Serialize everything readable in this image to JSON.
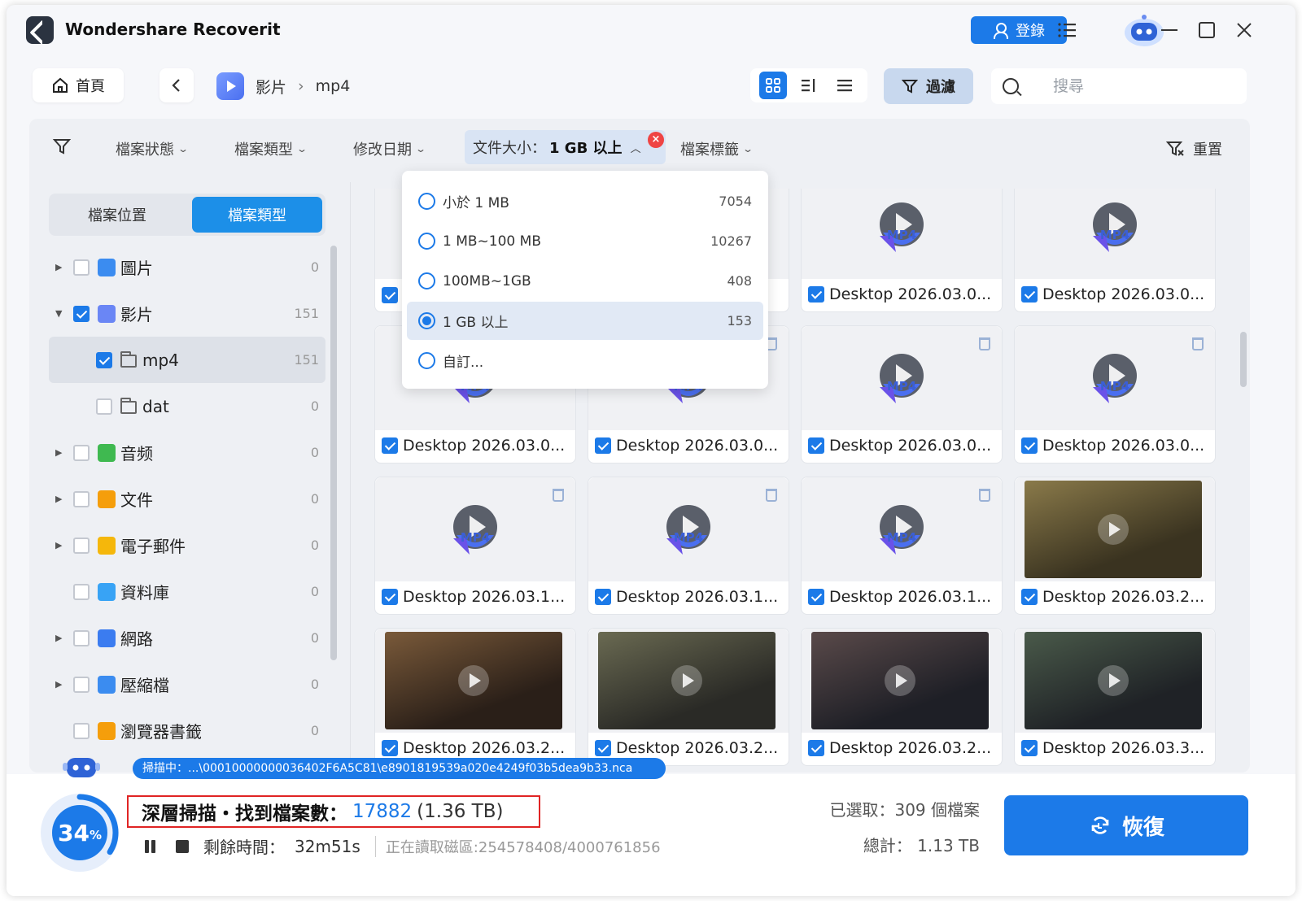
{
  "app": {
    "title": "Wondershare Recoverit",
    "login_label": "登錄"
  },
  "toolbar": {
    "home_label": "首頁",
    "breadcrumb": [
      "影片",
      "mp4"
    ],
    "breadcrumb_sep": "›",
    "filter_label": "過濾",
    "search_placeholder": "搜尋",
    "view_mode_active": "grid"
  },
  "filter_bar": {
    "items": [
      "檔案狀態",
      "檔案類型",
      "修改日期",
      "檔案標籤"
    ],
    "size_filter_prefix": "文件大小：",
    "size_filter_value": "1 GB 以上",
    "reset_label": "重置"
  },
  "dropdown": {
    "options": [
      {
        "label": "小於 1 MB",
        "count": "7054",
        "selected": false
      },
      {
        "label": "1 MB~100 MB",
        "count": "10267",
        "selected": false
      },
      {
        "label": "100MB~1GB",
        "count": "408",
        "selected": false
      },
      {
        "label": "1 GB 以上",
        "count": "153",
        "selected": true
      },
      {
        "label": "自訂...",
        "count": "",
        "selected": false
      }
    ]
  },
  "sidebar": {
    "tabs": [
      "檔案位置",
      "檔案類型"
    ],
    "active_tab": "檔案類型",
    "tree": [
      {
        "label": "圖片",
        "count": "0",
        "checked": false,
        "expandable": true,
        "icon": "image-icon",
        "color": "#3b8cf0"
      },
      {
        "label": "影片",
        "count": "151",
        "checked": true,
        "expandable": true,
        "expanded": true,
        "icon": "video-icon",
        "color": "#6a86f5"
      },
      {
        "label": "mp4",
        "count": "151",
        "checked": true,
        "child": true,
        "selected": true,
        "icon": "folder-icon"
      },
      {
        "label": "dat",
        "count": "0",
        "checked": false,
        "child": true,
        "icon": "folder-icon"
      },
      {
        "label": "音频",
        "count": "0",
        "checked": false,
        "expandable": true,
        "icon": "audio-icon",
        "color": "#3fb950"
      },
      {
        "label": "文件",
        "count": "0",
        "checked": false,
        "expandable": true,
        "icon": "document-icon",
        "color": "#f59e0b"
      },
      {
        "label": "電子郵件",
        "count": "0",
        "checked": false,
        "expandable": true,
        "icon": "email-icon",
        "color": "#f5b70b"
      },
      {
        "label": "資料庫",
        "count": "0",
        "checked": false,
        "expandable": false,
        "icon": "database-icon",
        "color": "#38a3f5"
      },
      {
        "label": "網路",
        "count": "0",
        "checked": false,
        "expandable": true,
        "icon": "web-icon",
        "color": "#3b7cf0"
      },
      {
        "label": "壓縮檔",
        "count": "0",
        "checked": false,
        "expandable": true,
        "icon": "archive-icon",
        "color": "#3b8cf0"
      },
      {
        "label": "瀏覽器書籤",
        "count": "0",
        "checked": false,
        "expandable": false,
        "icon": "bookmark-icon",
        "color": "#f59e0b"
      }
    ]
  },
  "grid": {
    "rows": [
      [
        {
          "name": "",
          "type": "mp4",
          "hidden_by_dropdown": true
        },
        {
          "name": "",
          "type": "mp4",
          "hidden_by_dropdown": true
        },
        {
          "name": "Desktop 2026.03.0...",
          "type": "mp4"
        },
        {
          "name": "Desktop 2026.03.0...",
          "type": "mp4"
        }
      ],
      [
        {
          "name": "Desktop 2026.03.0...",
          "type": "mp4"
        },
        {
          "name": "Desktop 2026.03.0...",
          "type": "mp4"
        },
        {
          "name": "Desktop 2026.03.0...",
          "type": "mp4"
        },
        {
          "name": "Desktop 2026.03.0...",
          "type": "mp4"
        }
      ],
      [
        {
          "name": "Desktop 2026.03.1...",
          "type": "mp4"
        },
        {
          "name": "Desktop 2026.03.1...",
          "type": "mp4"
        },
        {
          "name": "Desktop 2026.03.1...",
          "type": "mp4"
        },
        {
          "name": "Desktop 2026.03.2...",
          "type": "preview",
          "preview_colors": [
            "#3a3320",
            "#8a7a4a"
          ]
        }
      ],
      [
        {
          "name": "Desktop 2026.03.2...",
          "type": "preview",
          "preview_colors": [
            "#2a1f18",
            "#7a5a3a"
          ]
        },
        {
          "name": "Desktop 2026.03.2...",
          "type": "preview",
          "preview_colors": [
            "#2a2a26",
            "#6a6a52"
          ]
        },
        {
          "name": "Desktop 2026.03.2...",
          "type": "preview",
          "preview_colors": [
            "#1e1f26",
            "#5a4a4a"
          ]
        },
        {
          "name": "Desktop 2026.03.3...",
          "type": "preview",
          "preview_colors": [
            "#1f2226",
            "#4a5a4a"
          ]
        }
      ]
    ],
    "mp4_label": "MP4"
  },
  "status": {
    "scan_path": "掃描中：...\\00010000000036402F6A5C81\\e8901819539a020e4249f03b5dea9b33.nca",
    "progress_value": "34",
    "progress_unit": "%",
    "found_label": "深層掃描・找到檔案數：",
    "found_count": "17882",
    "found_size": "(1.36 TB)",
    "remaining_label": "剩餘時間：",
    "remaining_value": "32m51s",
    "reading": "正在讀取磁區:254578408/4000761856",
    "selected_label": "已選取：309 個檔案",
    "total_label": "總計：  1.13 TB",
    "recover_label": "恢復"
  },
  "colors": {
    "accent": "#1c7ae8",
    "danger": "#e02424"
  }
}
